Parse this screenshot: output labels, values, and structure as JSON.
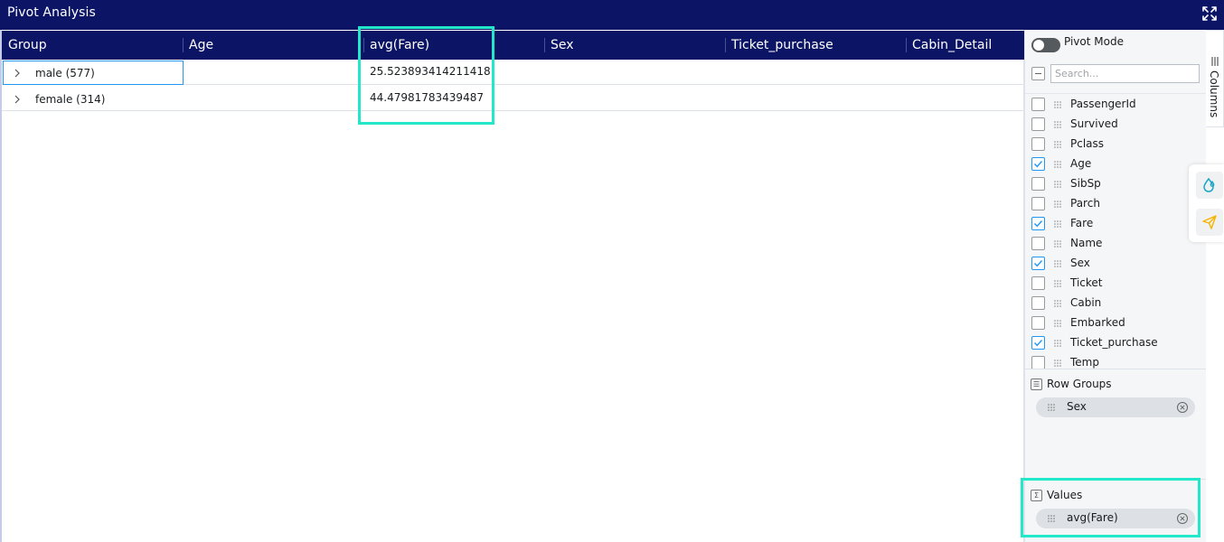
{
  "window": {
    "title": "Pivot Analysis",
    "expand_icon": "expand-arrows-icon"
  },
  "grid": {
    "columns": [
      {
        "label": "Group"
      },
      {
        "label": "Age"
      },
      {
        "label": "avg(Fare)"
      },
      {
        "label": "Sex"
      },
      {
        "label": "Ticket_purchase"
      },
      {
        "label": "Cabin_Detail"
      }
    ],
    "rows": [
      {
        "group": "male (577)",
        "avg_fare": "25.523893414211418"
      },
      {
        "group": "female (314)",
        "avg_fare": "44.47981783439487"
      }
    ]
  },
  "panel": {
    "pivot_mode_label": "Pivot Mode",
    "search_placeholder": "Search...",
    "columns": [
      {
        "name": "PassengerId",
        "checked": false
      },
      {
        "name": "Survived",
        "checked": false
      },
      {
        "name": "Pclass",
        "checked": false
      },
      {
        "name": "Age",
        "checked": true
      },
      {
        "name": "SibSp",
        "checked": false
      },
      {
        "name": "Parch",
        "checked": false
      },
      {
        "name": "Fare",
        "checked": true
      },
      {
        "name": "Name",
        "checked": false
      },
      {
        "name": "Sex",
        "checked": true
      },
      {
        "name": "Ticket",
        "checked": false
      },
      {
        "name": "Cabin",
        "checked": false
      },
      {
        "name": "Embarked",
        "checked": false
      },
      {
        "name": "Ticket_purchase",
        "checked": true
      },
      {
        "name": "Temp",
        "checked": false
      }
    ],
    "row_groups": {
      "title": "Row Groups",
      "items": [
        {
          "label": "Sex"
        }
      ]
    },
    "values": {
      "title": "Values",
      "items": [
        {
          "label": "avg(Fare)"
        }
      ]
    }
  },
  "side_tab": {
    "label": "Columns"
  },
  "colors": {
    "header_bg": "#0c1466",
    "highlight": "#22e8c9",
    "checkbox_accent": "#2196f3",
    "drop_icon": "#1aa7c7",
    "send_icon": "#f5b400"
  }
}
